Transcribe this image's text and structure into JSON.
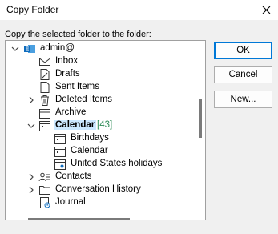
{
  "window": {
    "title": "Copy Folder"
  },
  "prompt": "Copy the selected folder to the folder:",
  "tree": {
    "account": "admin@",
    "items": [
      {
        "label": "Inbox"
      },
      {
        "label": "Drafts"
      },
      {
        "label": "Sent Items"
      },
      {
        "label": "Deleted Items"
      },
      {
        "label": "Archive"
      },
      {
        "label": "Calendar",
        "count": "[43]"
      },
      {
        "label": "Birthdays"
      },
      {
        "label": "Calendar"
      },
      {
        "label": "United States holidays"
      },
      {
        "label": "Contacts"
      },
      {
        "label": "Conversation History"
      },
      {
        "label": "Journal"
      }
    ]
  },
  "buttons": {
    "ok": "OK",
    "cancel": "Cancel",
    "new": "New..."
  },
  "colors": {
    "accent": "#0078d7",
    "selection": "#cce8ff",
    "count": "#2e8b57"
  }
}
